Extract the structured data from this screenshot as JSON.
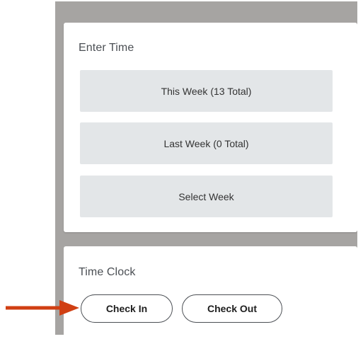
{
  "enter_time": {
    "title": "Enter Time",
    "buttons": [
      {
        "label": "This Week (13 Total)"
      },
      {
        "label": "Last Week (0 Total)"
      },
      {
        "label": "Select Week"
      }
    ]
  },
  "time_clock": {
    "title": "Time Clock",
    "check_in_label": "Check In",
    "check_out_label": "Check Out"
  },
  "colors": {
    "backdrop": "#a6a4a2",
    "panel": "#ffffff",
    "week_button_bg": "#e3e6e8",
    "title_text": "#4b4f54",
    "arrow": "#d03f13"
  },
  "icons": {
    "annotation": "right-arrow-icon"
  }
}
